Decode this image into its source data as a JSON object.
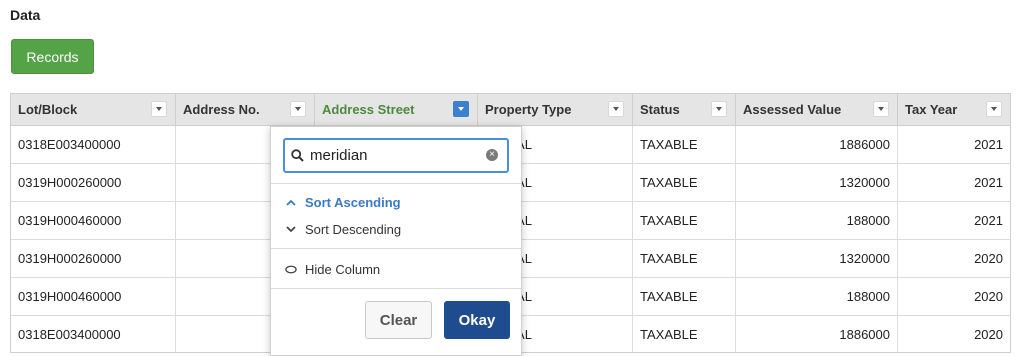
{
  "section": {
    "title": "Data"
  },
  "records_button": "Records",
  "table": {
    "columns": [
      "Lot/Block",
      "Address No.",
      "Address Street",
      "Property Type",
      "Status",
      "Assessed Value",
      "Tax Year"
    ],
    "rows": [
      [
        "0318E003400000",
        "",
        "",
        "ERCIAL",
        "TAXABLE",
        "1886000",
        "2021"
      ],
      [
        "0319H000260000",
        "",
        "",
        "ERCIAL",
        "TAXABLE",
        "1320000",
        "2021"
      ],
      [
        "0319H000460000",
        "",
        "",
        "ERCIAL",
        "TAXABLE",
        "188000",
        "2021"
      ],
      [
        "0319H000260000",
        "",
        "",
        "ERCIAL",
        "TAXABLE",
        "1320000",
        "2020"
      ],
      [
        "0319H000460000",
        "",
        "",
        "ERCIAL",
        "TAXABLE",
        "188000",
        "2020"
      ],
      [
        "0318E003400000",
        "",
        "",
        "ERCIAL",
        "TAXABLE",
        "1886000",
        "2020"
      ]
    ],
    "active_column": "Address Street"
  },
  "popup": {
    "search_value": "meridian",
    "sort_ascending": "Sort Ascending",
    "sort_descending": "Sort Descending",
    "hide_column": "Hide Column",
    "clear_label": "Clear",
    "okay_label": "Okay"
  },
  "colors": {
    "accent_green": "#55a347",
    "active_header_text": "#4b8a3e",
    "primary_blue": "#1f4c8f",
    "link_blue": "#3a78c8"
  },
  "icons": [
    "dropdown-caret-icon",
    "search-icon",
    "clear-x-icon",
    "chevron-up-icon",
    "chevron-down-icon",
    "eye-icon"
  ]
}
